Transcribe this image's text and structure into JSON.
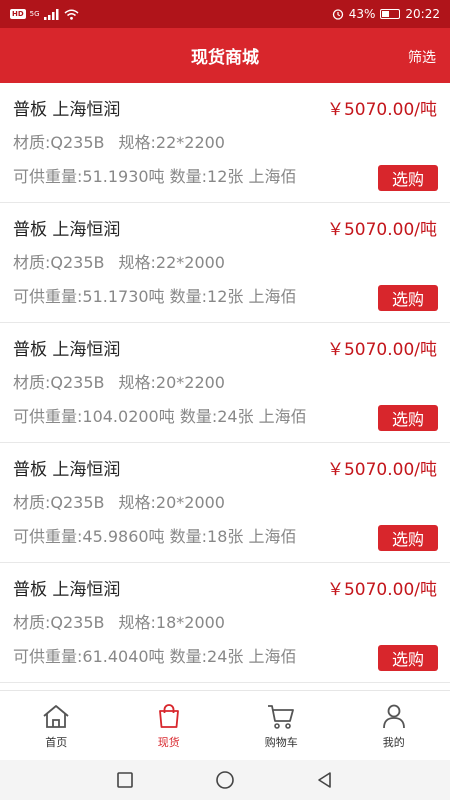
{
  "status_bar": {
    "hd": "HD",
    "signal_text": "5G",
    "battery": "43%",
    "time": "20:22",
    "battery_level": 0.43
  },
  "header": {
    "title": "现货商城",
    "filter_label": "筛选"
  },
  "products": [
    {
      "name": "普板 上海恒润",
      "price": "￥5070.00/吨",
      "material": "材质:Q235B",
      "spec": "规格:22*2200",
      "stock": "可供重量:51.1930吨 数量:12张 上海佰",
      "buy_label": "选购"
    },
    {
      "name": "普板 上海恒润",
      "price": "￥5070.00/吨",
      "material": "材质:Q235B",
      "spec": "规格:22*2000",
      "stock": "可供重量:51.1730吨 数量:12张 上海佰",
      "buy_label": "选购"
    },
    {
      "name": "普板 上海恒润",
      "price": "￥5070.00/吨",
      "material": "材质:Q235B",
      "spec": "规格:20*2200",
      "stock": "可供重量:104.0200吨 数量:24张 上海佰",
      "buy_label": "选购"
    },
    {
      "name": "普板 上海恒润",
      "price": "￥5070.00/吨",
      "material": "材质:Q235B",
      "spec": "规格:20*2000",
      "stock": "可供重量:45.9860吨 数量:18张 上海佰",
      "buy_label": "选购"
    },
    {
      "name": "普板 上海恒润",
      "price": "￥5070.00/吨",
      "material": "材质:Q235B",
      "spec": "规格:18*2000",
      "stock": "可供重量:61.4040吨 数量:24张 上海佰",
      "buy_label": "选购"
    }
  ],
  "tabs": [
    {
      "label": "首页",
      "icon": "home-icon",
      "active": false
    },
    {
      "label": "现货",
      "icon": "shopping-bag-icon",
      "active": true
    },
    {
      "label": "购物车",
      "icon": "cart-icon",
      "active": false
    },
    {
      "label": "我的",
      "icon": "user-icon",
      "active": false
    }
  ],
  "colors": {
    "brand_red": "#d8262c",
    "status_red": "#b0141a",
    "price_red": "#c4161c"
  }
}
